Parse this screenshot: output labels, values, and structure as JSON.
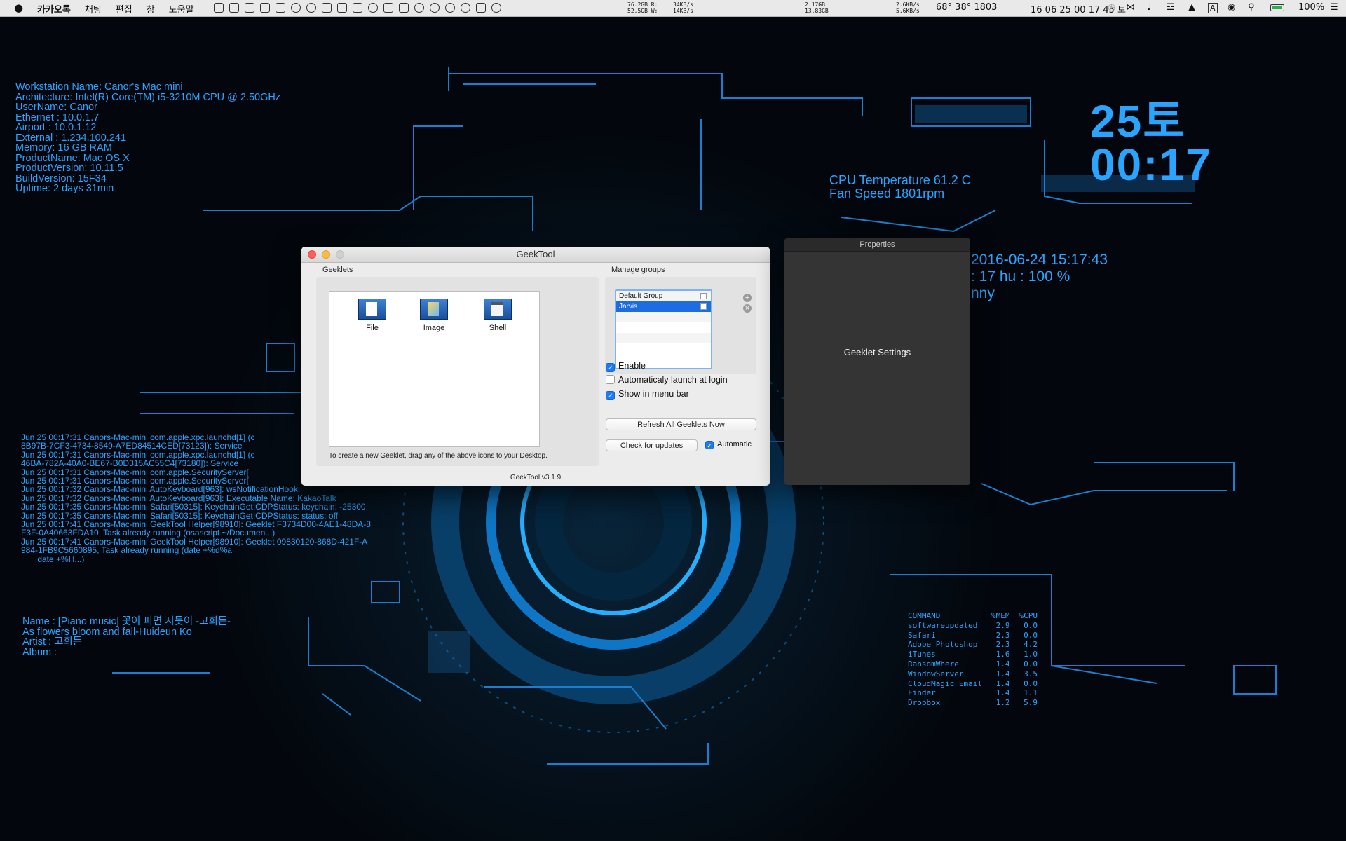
{
  "menubar": {
    "apple": "",
    "menus": [
      "카카오톡",
      "채팅",
      "편집",
      "창",
      "도움말"
    ],
    "disk_read": "76.2GB R:",
    "disk_write": "52.5GB W:",
    "disk_read_rate": "34KB/s",
    "disk_write_rate": "14KB/s",
    "mem_used": "2.17GB",
    "mem_free": "13.83GB",
    "net_up": "2.6KB/s",
    "net_down": "5.6KB/s",
    "temps": "68° 38° 1803",
    "clock": "16 06 25 00 17 45 토",
    "battery_percent": "100%",
    "icon_names": [
      "notes-icon",
      "clipboard-icon",
      "list-icon",
      "terminal-icon",
      "disk-icon",
      "clock-icon",
      "vpn-icon",
      "window-icon",
      "grid-icon",
      "folder-icon",
      "info-icon",
      "dropbox-icon",
      "script-icon",
      "compass-icon",
      "drop-icon",
      "sync-icon",
      "info-circle-icon",
      "keyboard-icon",
      "notification-icon"
    ],
    "input_source": "A"
  },
  "sysinfo": {
    "lines": [
      "Workstation Name:  Canor's Mac mini",
      "Architecture:  Intel(R) Core(TM) i5-3210M CPU @ 2.50GHz",
      "UserName:  Canor",
      "Ethernet : 10.0.1.7",
      "Airport : 10.0.1.12",
      "External : 1.234.100.241",
      "Memory:  16 GB RAM",
      "ProductName: Mac OS X",
      "ProductVersion:    10.11.5",
      "BuildVersion:   15F34",
      "Uptime: 2 days 31min"
    ]
  },
  "clock_widget": {
    "day": "25토",
    "time": "00:17"
  },
  "cpu_widget": {
    "temp": "CPU Temperature 61.2   C",
    "fan": "Fan Speed 1801rpm"
  },
  "weather_widget": {
    "datetime": "2016-06-24 15:17:43",
    "humidity": ": 17 hu : 100  %",
    "condition": "nny"
  },
  "syslog": {
    "lines": [
      "Jun 25 00:17:31 Canors-Mac-mini com.apple.xpc.launchd[1] (c",
      "8B97B-7CF3-4734-8549-A7ED84514CED[73123]): Service",
      "Jun 25 00:17:31 Canors-Mac-mini com.apple.xpc.launchd[1] (c",
      "46BA-782A-40A0-BE67-B0D315AC55C4[73180]): Service",
      "Jun 25 00:17:31 Canors-Mac-mini com.apple.SecurityServer[",
      "Jun 25 00:17:31 Canors-Mac-mini com.apple.SecurityServer[",
      "Jun 25 00:17:32 Canors-Mac-mini AutoKeyboard[963]: wsNotificationHook:",
      "Jun 25 00:17:32 Canors-Mac-mini AutoKeyboard[963]: Executable Name: KakaoTalk",
      "Jun 25 00:17:35 Canors-Mac-mini Safari[50315]: KeychainGetICDPStatus: keychain: -25300",
      "Jun 25 00:17:35 Canors-Mac-mini Safari[50315]: KeychainGetICDPStatus: status: off",
      "Jun 25 00:17:41 Canors-Mac-mini GeekTool Helper[98910]: Geeklet F3734D00-4AE1-48DA-8",
      "F3F-0A40663FDA10, Task already running (osascript ~/Documen...)",
      "Jun 25 00:17:41 Canors-Mac-mini GeekTool Helper[98910]: Geeklet 09830120-868D-421F-A",
      "984-1FB9C5660895, Task already running (date +%d%a",
      "       date +%H...)"
    ]
  },
  "music": {
    "lines": [
      "Name : [Piano music] 꽃이 피면 지듯이 -고희든-",
      "As flowers bloom and fall-Huideun Ko",
      "Artist : 고희든",
      "Album :"
    ]
  },
  "processes": {
    "headers": [
      "COMMAND",
      "%MEM",
      "%CPU"
    ],
    "rows": [
      [
        "softwareupdated",
        "2.9",
        "0.0"
      ],
      [
        "Safari",
        "2.3",
        "0.0"
      ],
      [
        "Adobe Photoshop",
        "2.3",
        "4.2"
      ],
      [
        "iTunes",
        "1.6",
        "1.0"
      ],
      [
        "RansomWhere",
        "1.4",
        "0.0"
      ],
      [
        "WindowServer",
        "1.4",
        "3.5"
      ],
      [
        "CloudMagic Email",
        "1.4",
        "0.0"
      ],
      [
        "Finder",
        "1.4",
        "1.1"
      ],
      [
        "Dropbox",
        "1.2",
        "5.9"
      ]
    ]
  },
  "geektool": {
    "title": "GeekTool",
    "geeklets_label": "Geeklets",
    "items": [
      {
        "label": "File",
        "icon": "file-geeklet-icon"
      },
      {
        "label": "Image",
        "icon": "image-geeklet-icon"
      },
      {
        "label": "Shell",
        "icon": "shell-geeklet-icon"
      }
    ],
    "hint": "To create a new Geeklet, drag any of the above icons to your Desktop.",
    "groups_label": "Manage groups",
    "groups": [
      {
        "name": "Default Group",
        "selected": false
      },
      {
        "name": "Jarvis",
        "selected": true
      }
    ],
    "add_glyph": "+",
    "remove_glyph": "×",
    "enable_label": "Enable",
    "enable_checked": true,
    "autolaunch_label": "Automaticaly launch at login",
    "autolaunch_checked": false,
    "menubar_label": "Show in menu bar",
    "menubar_checked": true,
    "refresh_label": "Refresh All Geeklets Now",
    "check_updates_label": "Check for updates",
    "automatic_label": "Automatic",
    "automatic_checked": true,
    "check_glyph": "✓",
    "version": "GeekTool v3.1.9"
  },
  "properties": {
    "title": "Properties",
    "body": "Geeklet Settings"
  },
  "colors": {
    "hud": "#2aa4ff",
    "selection": "#1d6ce2",
    "desktop": "#03070d"
  }
}
